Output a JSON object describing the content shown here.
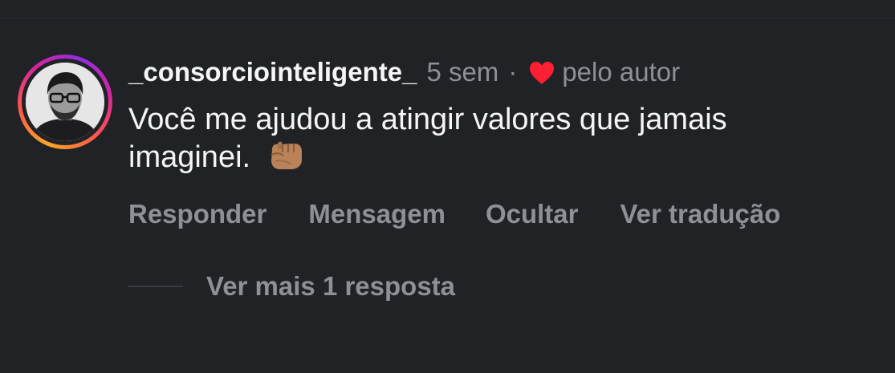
{
  "comment": {
    "username": "_consorciointeligente_",
    "time_ago": "5 sem",
    "separator": "·",
    "liked_by_author": "pelo autor",
    "text": "Você me ajudou a atingir valores que jamais imaginei.",
    "emoji": "fist-bump-emoji"
  },
  "actions": {
    "reply": "Responder",
    "message": "Mensagem",
    "hide": "Ocultar",
    "translate": "Ver tradução"
  },
  "replies": {
    "view_more": "Ver mais 1 resposta"
  },
  "colors": {
    "background": "#212226",
    "primary_text": "#f5f5f5",
    "secondary_text": "#8e9096",
    "heart": "#ff1f33"
  }
}
